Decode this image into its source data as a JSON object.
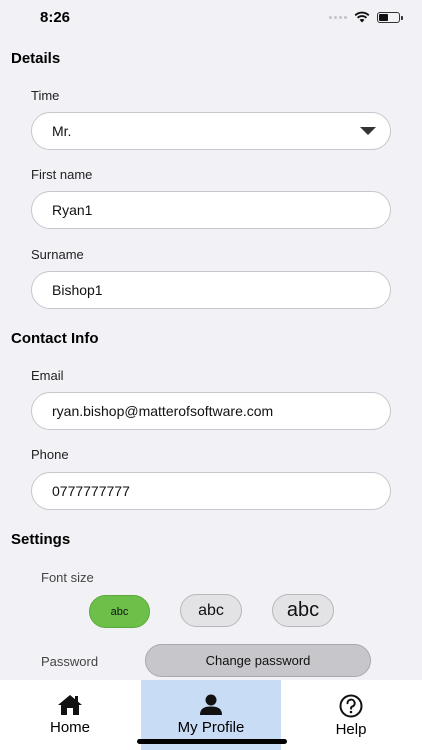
{
  "status_bar": {
    "time": "8:26"
  },
  "details": {
    "title": "Details",
    "title_field": {
      "label": "Time",
      "value": "Mr."
    },
    "first_name": {
      "label": "First name",
      "value": "Ryan1"
    },
    "surname": {
      "label": "Surname",
      "value": "Bishop1"
    }
  },
  "contact": {
    "title": "Contact Info",
    "email": {
      "label": "Email",
      "value": "ryan.bishop@matterofsoftware.com"
    },
    "phone": {
      "label": "Phone",
      "value": "0777777777"
    }
  },
  "settings": {
    "title": "Settings",
    "font_size_label": "Font size",
    "font_options": [
      "abc",
      "abc",
      "abc"
    ],
    "selected_font_index": 0,
    "password_label": "Password",
    "change_password_label": "Change password"
  },
  "tabs": [
    {
      "label": "Home",
      "icon": "home-icon"
    },
    {
      "label": "My Profile",
      "icon": "person-icon",
      "active": true
    },
    {
      "label": "Help",
      "icon": "help-icon"
    }
  ],
  "colors": {
    "active_tab": "#c8dcf5",
    "selected_font": "#6cc04a",
    "background": "#f2f1f6"
  }
}
